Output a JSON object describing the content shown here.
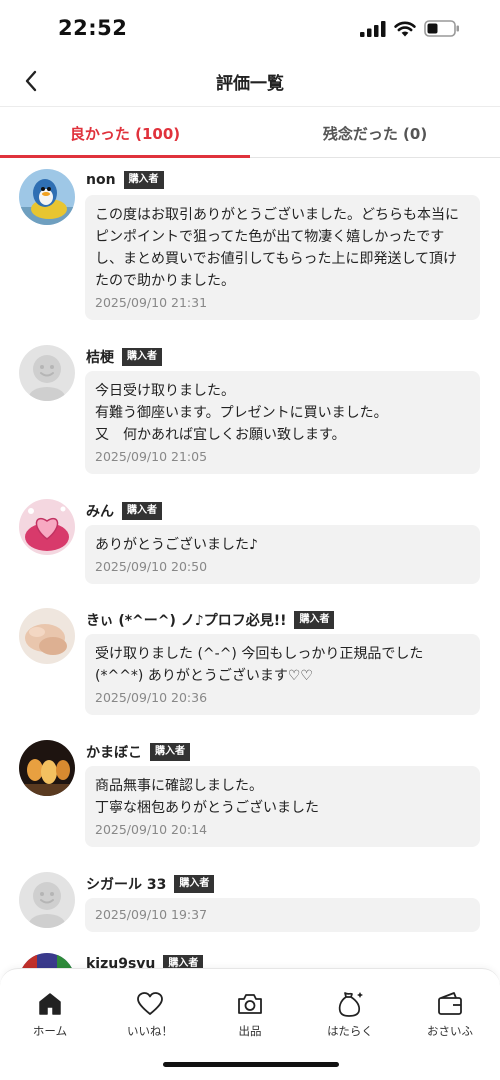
{
  "status_bar": {
    "time": "22:52"
  },
  "header": {
    "title": "評価一覧",
    "back_icon": "chevron-left-icon"
  },
  "tabs": [
    {
      "label": "良かった (100)",
      "active": true
    },
    {
      "label": "残念だった (0)",
      "active": false
    }
  ],
  "reviews": [
    {
      "name": "non",
      "badge": "購入者",
      "comment": "この度はお取引ありがとうございました。どちらも本当にピンポイントで狙ってた色が出て物凄く嬉しかったですし、まとめ買いでお値引してもらった上に即発送して頂けたので助かりました。",
      "date": "2025/09/10 21:31"
    },
    {
      "name": "桔梗",
      "badge": "購入者",
      "comment": "今日受け取りました。\n有難う御座います。プレゼントに買いました。\n又　何かあれば宜しくお願い致します。",
      "date": "2025/09/10 21:05"
    },
    {
      "name": "みん",
      "badge": "購入者",
      "comment": "ありがとうございました♪",
      "date": "2025/09/10 20:50"
    },
    {
      "name": "きぃ (*^ー^) ノ♪プロフ必見!!",
      "badge": "購入者",
      "comment": "受け取りました (^-^) 今回もしっかり正規品でした (*^^*) ありがとうございます♡♡",
      "date": "2025/09/10 20:36"
    },
    {
      "name": "かまぼこ",
      "badge": "購入者",
      "comment": "商品無事に確認しました。\n丁寧な梱包ありがとうございました",
      "date": "2025/09/10 20:14"
    },
    {
      "name": "シガール 33",
      "badge": "購入者",
      "comment": "",
      "date": "2025/09/10 19:37"
    },
    {
      "name": "kizu9svu",
      "badge": "購入者",
      "comment": "",
      "date": ""
    }
  ],
  "bottom_nav": [
    {
      "label": "ホーム",
      "icon": "home-icon",
      "active": true
    },
    {
      "label": "いいね！",
      "icon": "heart-icon",
      "active": false
    },
    {
      "label": "出品",
      "icon": "camera-icon",
      "active": false
    },
    {
      "label": "はたらく",
      "icon": "money-bag-icon",
      "active": false
    },
    {
      "label": "おさいふ",
      "icon": "wallet-icon",
      "active": false
    }
  ],
  "colors": {
    "accent": "#e0323c",
    "badge_bg": "#333333",
    "bubble_bg": "#f2f2f2"
  }
}
